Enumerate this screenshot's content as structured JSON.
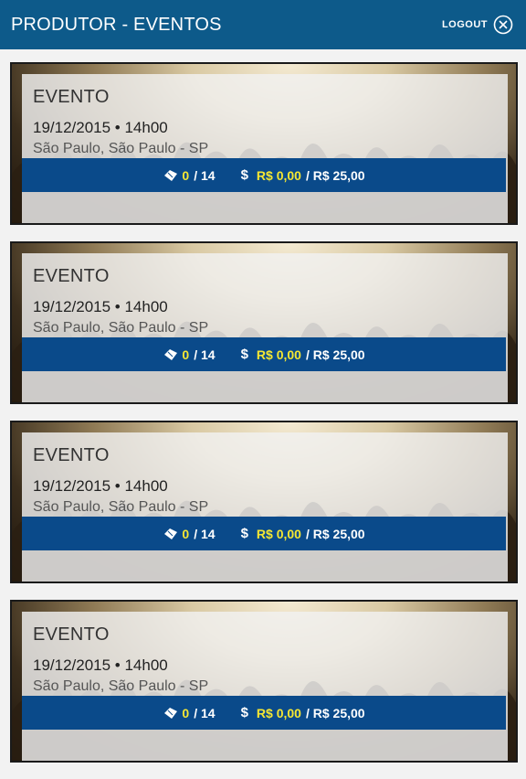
{
  "app": {
    "title": "PRODUTOR - EVENTOS",
    "logout_label": "LOGOUT"
  },
  "colors": {
    "appbar": "#0d5a8a",
    "statsbar": "#0a4a8a",
    "highlight": "#f5e733"
  },
  "events": [
    {
      "name": "EVENTO",
      "datetime": "19/12/2015 • 14h00",
      "location": "São Paulo, São Paulo - SP",
      "tickets_sold": "0",
      "tickets_total": "/ 14",
      "revenue": "R$ 0,00",
      "revenue_total": "/ R$ 25,00"
    },
    {
      "name": "EVENTO",
      "datetime": "19/12/2015 • 14h00",
      "location": "São Paulo, São Paulo - SP",
      "tickets_sold": "0",
      "tickets_total": "/ 14",
      "revenue": "R$ 0,00",
      "revenue_total": "/ R$ 25,00"
    },
    {
      "name": "EVENTO",
      "datetime": "19/12/2015 • 14h00",
      "location": "São Paulo, São Paulo - SP",
      "tickets_sold": "0",
      "tickets_total": "/ 14",
      "revenue": "R$ 0,00",
      "revenue_total": "/ R$ 25,00"
    },
    {
      "name": "EVENTO",
      "datetime": "19/12/2015 • 14h00",
      "location": "São Paulo, São Paulo - SP",
      "tickets_sold": "0",
      "tickets_total": "/ 14",
      "revenue": "R$ 0,00",
      "revenue_total": "/ R$ 25,00"
    }
  ],
  "icons": {
    "logout": "close-circle-icon",
    "tickets": "ticket-icon",
    "revenue": "dollar-icon"
  }
}
